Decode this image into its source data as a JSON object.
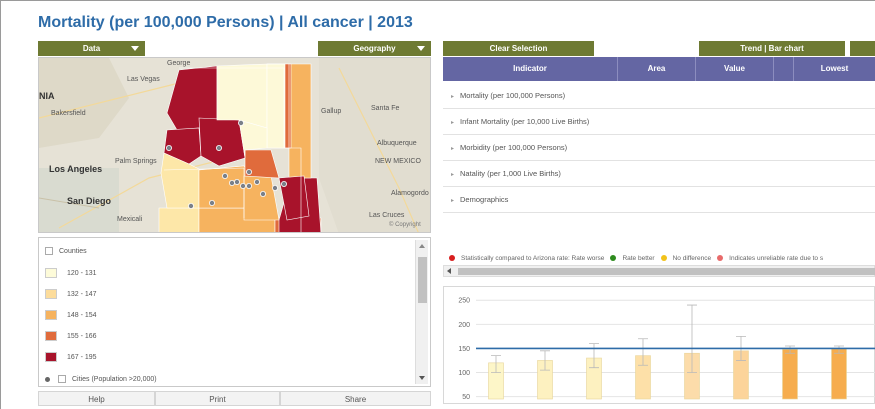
{
  "title": "Mortality (per 100,000 Persons) | All cancer | 2013",
  "buttons": {
    "data": "Data",
    "geography": "Geography",
    "clear_selection": "Clear Selection",
    "trend_bar": "Trend | Bar chart"
  },
  "map": {
    "labels": [
      "Las Vegas",
      "Bakersfield",
      "Los Angeles",
      "San Diego",
      "Palm Springs",
      "Mexicali",
      "Gallup",
      "Santa Fe",
      "Albuquerque",
      "NEW MEXICO",
      "Alamogordo",
      "Las Cruces",
      "George",
      "© Copyright"
    ],
    "edge_text": "NIA",
    "counties_fill": [
      "#a8132b",
      "#a8132b",
      "#a8132b",
      "#fdf9d8",
      "#fdf9d8",
      "#fde7a8",
      "#fde7a8",
      "#f6b35f",
      "#f6b35f",
      "#e06b3c",
      "#e06b3c",
      "#a8132b",
      "#fdf9d8"
    ]
  },
  "legend": {
    "header": "Counties",
    "items": [
      {
        "label": "120 - 131",
        "color": "#fdfbd9"
      },
      {
        "label": "132 - 147",
        "color": "#fcdc9b"
      },
      {
        "label": "148 - 154",
        "color": "#f6b35f"
      },
      {
        "label": "155 - 166",
        "color": "#e06b3c"
      },
      {
        "label": "167 - 195",
        "color": "#a8132b"
      }
    ],
    "cities": "Cities (Population >20,000)"
  },
  "footer": {
    "help": "Help",
    "print": "Print",
    "share": "Share"
  },
  "table": {
    "columns": [
      "Indicator",
      "Area",
      "Value",
      "",
      "Lowest"
    ],
    "rows": [
      "Mortality (per 100,000 Persons)",
      "Infant Mortality (per 10,000 Live Births)",
      "Morbidity (per 100,000 Persons)",
      "Natality (per 1,000 Live Births)",
      "Demographics"
    ]
  },
  "significance": [
    {
      "label": "Statistically compared to Arizona rate: Rate worse",
      "color": "#d81e1e"
    },
    {
      "label": "Rate better",
      "color": "#2e8b1e"
    },
    {
      "label": "No difference",
      "color": "#f2c21a"
    },
    {
      "label": "Indicates unreliable rate due to s",
      "color": "#e86a6a"
    }
  ],
  "chart_data": {
    "type": "bar",
    "yticks": [
      50,
      100,
      150,
      200,
      250
    ],
    "ylim": [
      45,
      265
    ],
    "reference_line": 150,
    "reference_color": "#2e6ca8",
    "values": [
      120,
      125,
      130,
      135,
      140,
      145,
      148,
      149
    ],
    "ci_low": [
      100,
      105,
      110,
      115,
      100,
      125,
      140,
      140
    ],
    "ci_high": [
      135,
      145,
      160,
      170,
      240,
      175,
      155,
      155
    ],
    "colors": [
      "#fdf6c8",
      "#fdf1c0",
      "#fdf1c0",
      "#fde0a8",
      "#fcdcaa",
      "#fcd49a",
      "#f6ad4e",
      "#f6ad4e"
    ]
  }
}
